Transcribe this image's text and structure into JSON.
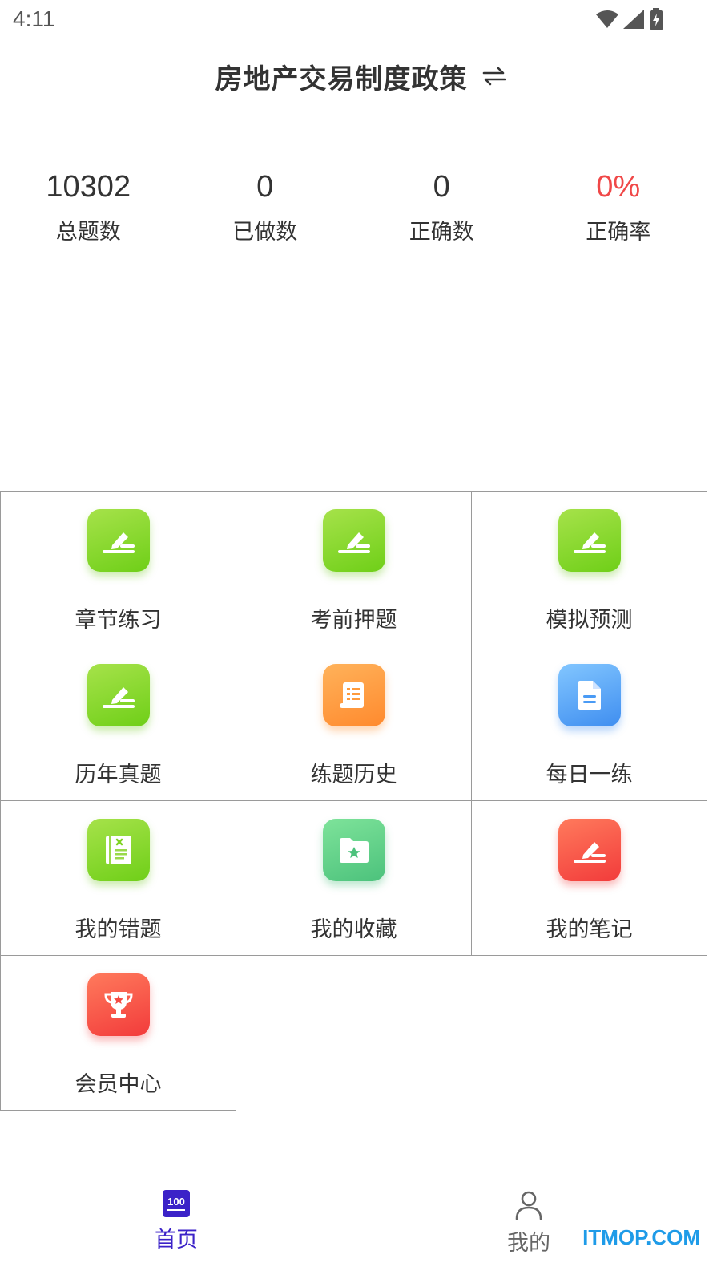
{
  "status_bar": {
    "time": "4:11"
  },
  "header": {
    "title": "房地产交易制度政策"
  },
  "stats": [
    {
      "value": "10302",
      "label": "总题数"
    },
    {
      "value": "0",
      "label": "已做数"
    },
    {
      "value": "0",
      "label": "正确数"
    },
    {
      "value": "0%",
      "label": "正确率"
    }
  ],
  "grid": [
    {
      "label": "章节练习",
      "icon": "edit-icon",
      "color": "#7ed321"
    },
    {
      "label": "考前押题",
      "icon": "edit-icon",
      "color": "#7ed321"
    },
    {
      "label": "模拟预测",
      "icon": "edit-icon",
      "color": "#7ed321"
    },
    {
      "label": "历年真题",
      "icon": "edit-icon",
      "color": "#7ed321"
    },
    {
      "label": "练题历史",
      "icon": "scroll-icon",
      "color": "#ff9a3c"
    },
    {
      "label": "每日一练",
      "icon": "document-icon",
      "color": "#4a9bf5"
    },
    {
      "label": "我的错题",
      "icon": "wrong-book-icon",
      "color": "#7ed321"
    },
    {
      "label": "我的收藏",
      "icon": "star-folder-icon",
      "color": "#5ccf8a"
    },
    {
      "label": "我的笔记",
      "icon": "edit-icon",
      "color": "#f54a42"
    },
    {
      "label": "会员中心",
      "icon": "trophy-icon",
      "color": "#f54a42"
    }
  ],
  "bottom_nav": {
    "home": {
      "label": "首页",
      "badge": "100",
      "color": "#3b22c8"
    },
    "me": {
      "label": "我的"
    }
  },
  "watermark": "ITMOP.COM"
}
